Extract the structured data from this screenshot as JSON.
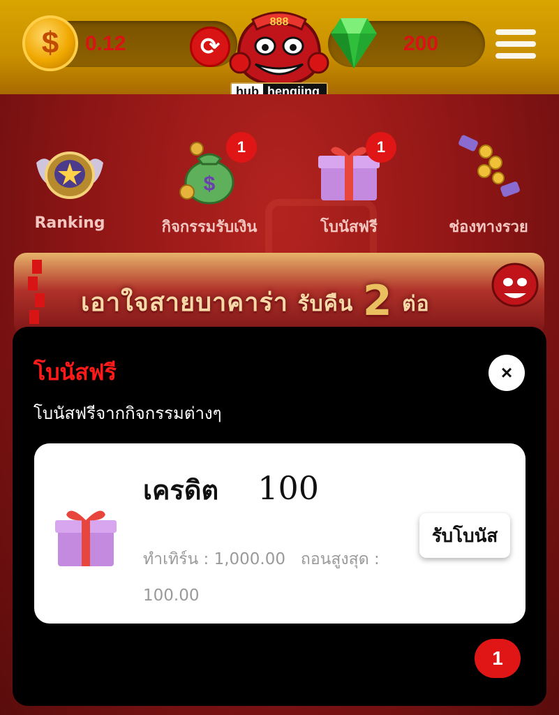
{
  "header": {
    "balance": "0.12",
    "coin_symbol": "$",
    "refresh_symbol": "⟳",
    "gems": "200",
    "logo_number": "888",
    "logo_part1": "hub",
    "logo_part2": "hengjing"
  },
  "menu": {
    "items": [
      {
        "label": "Ranking",
        "icon": "ranking-badge-icon",
        "badge": ""
      },
      {
        "label": "กิจกรรมรับเงิน",
        "icon": "money-bag-icon",
        "badge": "1"
      },
      {
        "label": "โบนัสฟรี",
        "icon": "gift-box-icon",
        "badge": "1"
      },
      {
        "label": "ช่องทางรวย",
        "icon": "coins-hand-icon",
        "badge": ""
      }
    ]
  },
  "banner": {
    "text_main": "เอาใจสายบาคาร่า",
    "text_sub": "รับคืน",
    "number": "2",
    "suffix": "ต่อ"
  },
  "modal": {
    "title": "โบนัสฟรี",
    "subtitle": "โบนัสฟรีจากกิจกรรมต่างๆ",
    "close_symbol": "×",
    "card": {
      "credit_label": "เครดิต",
      "credit_value": "100",
      "turnover_label": "ทำเทิร์น :",
      "turnover_value": "1,000.00",
      "max_withdraw_label": "ถอนสูงสุด :",
      "max_withdraw_value": "100.00",
      "claim_button": "รับโบนัส"
    },
    "page_badge": "1"
  },
  "colors": {
    "accent_red": "#e01616",
    "gold": "#d9a500",
    "title_red": "#ff1a1a"
  }
}
